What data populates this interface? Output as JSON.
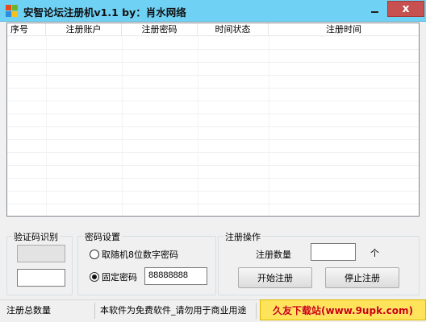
{
  "window": {
    "title": "安智论坛注册机v1.1  by：肖水网络",
    "minimize_label": "",
    "close_label": "x"
  },
  "list": {
    "columns": [
      "序号",
      "注册账户",
      "注册密码",
      "时间状态",
      "注册时间"
    ],
    "rows": []
  },
  "captcha_group": {
    "title": "验证码识别",
    "code_value": ""
  },
  "password_group": {
    "title": "密码设置",
    "options": [
      {
        "label": "取随机8位数字密码",
        "selected": false
      },
      {
        "label": "固定密码",
        "selected": true
      }
    ],
    "fixed_password_value": "88888888"
  },
  "register_group": {
    "title": "注册操作",
    "count_label": "注册数量",
    "count_value": "",
    "count_unit": "个",
    "start_button": "开始注册",
    "stop_button": "停止注册"
  },
  "status_bar": {
    "total_label": "注册总数量",
    "notice": "本软件为免费软件_请勿用于商业用途",
    "extra": "",
    "watermark": "久友下载站(www.9upk.com)"
  },
  "colors": {
    "titlebar": "#6fd1f4",
    "close_button": "#c75050",
    "watermark_bg": "#ffe35a",
    "watermark_text": "#cc0000"
  }
}
